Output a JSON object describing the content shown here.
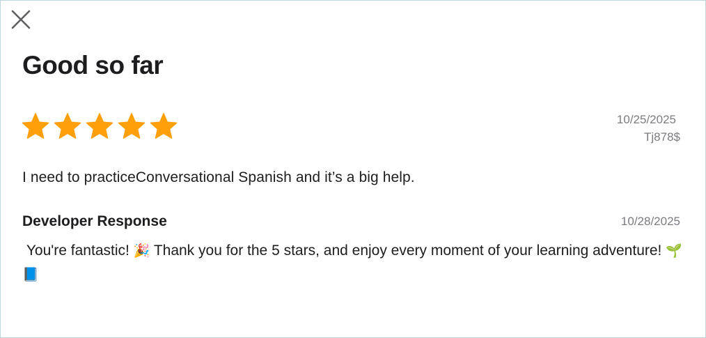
{
  "dialog": {
    "close_icon": "close-icon"
  },
  "review": {
    "title": "Good so far",
    "rating": 5,
    "rating_max": 5,
    "star_color": "#ff9f0a",
    "date": "10/25/2025",
    "author": "Tj878$",
    "body": "I need to practiceConversational Spanish and it’s a big help."
  },
  "developer_response": {
    "heading": "Developer Response",
    "date": "10/28/2025",
    "text_part1": " You're fantastic! ",
    "emoji_party": "🎉",
    "text_part2": " Thank you for the 5 stars, and enjoy every moment of your learning adventure! ",
    "emoji_seedling": "🌱",
    "emoji_book": "📘"
  }
}
